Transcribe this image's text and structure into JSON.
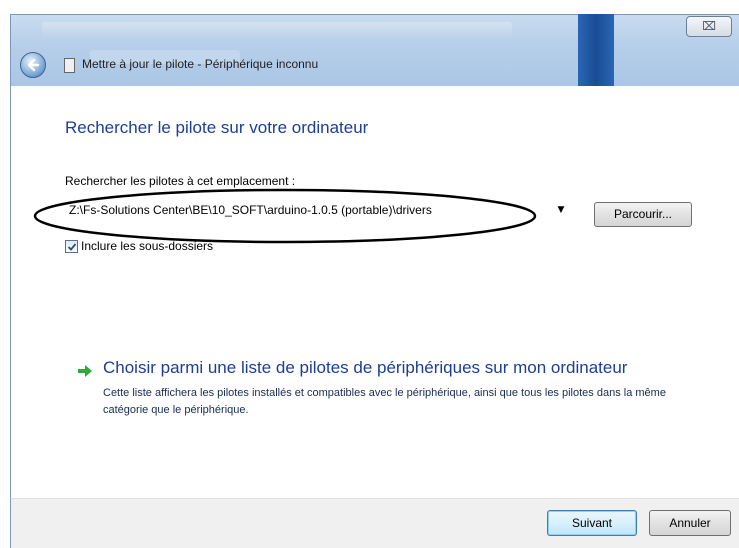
{
  "dialog": {
    "title": "Mettre à jour le pilote - Périphérique inconnu",
    "close_symbol": "⌧"
  },
  "content": {
    "heading": "Rechercher le pilote sur votre ordinateur",
    "location_label": "Rechercher les pilotes à cet emplacement :",
    "location_value": "Z:\\Fs-Solutions Center\\BE\\10_SOFT\\arduino-1.0.5 (portable)\\drivers",
    "browse_label": "Parcourir...",
    "include_subfolders_label": "Inclure les sous-dossiers",
    "include_subfolders_checked": true,
    "choose_title": "Choisir parmi une liste de pilotes de périphériques sur mon ordinateur",
    "choose_description": "Cette liste affichera les pilotes installés et compatibles avec le périphérique, ainsi que tous les pilotes dans la même catégorie que le périphérique."
  },
  "footer": {
    "next_label": "Suivant",
    "cancel_label": "Annuler"
  },
  "icons": {
    "back": "back-arrow-icon",
    "device": "device-icon",
    "choose": "green-arrow-icon",
    "dropdown": "chevron-down-icon"
  },
  "colors": {
    "heading": "#1c3e94",
    "titlebar": "#b7cfe9",
    "arrow": "#2eaa3a"
  }
}
